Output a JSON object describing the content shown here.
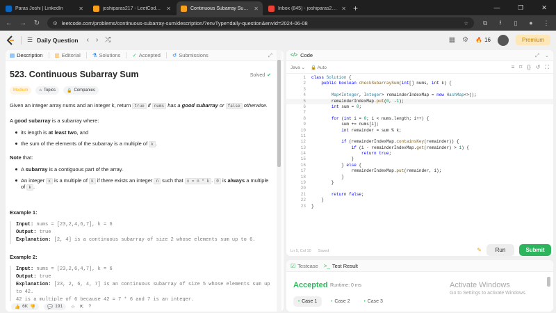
{
  "browser": {
    "tabs": [
      {
        "title": "Paras Joshi | LinkedIn",
        "color": "#0a66c2",
        "active": false
      },
      {
        "title": "joshiparas217 - LeetCode Profile",
        "color": "#f89f1b",
        "active": false
      },
      {
        "title": "Continuous Subarray Sum - LeetCode",
        "color": "#f89f1b",
        "active": true
      },
      {
        "title": "Inbox (845) - joshiparas217@gmail.com",
        "color": "#ea4335",
        "active": false
      }
    ],
    "url": "leetcode.com/problems/continuous-subarray-sum/description/?envType=daily-question&envId=2024-06-08"
  },
  "header": {
    "daily_question": "Daily Question",
    "streak": "16",
    "premium": "Premium"
  },
  "left_tabs": [
    "Description",
    "Editorial",
    "Solutions",
    "Accepted",
    "Submissions"
  ],
  "problem": {
    "title": "523. Continuous Subarray Sum",
    "solved": "Solved",
    "difficulty": "Medium",
    "topics": "Topics",
    "companies": "Companies",
    "intro_1": "Given an integer array nums and an integer k, return",
    "intro_true": "true",
    "intro_2": "if",
    "intro_nums": "nums",
    "intro_3": "has a",
    "intro_good": "good subarray",
    "intro_4": "or",
    "intro_false": "false",
    "intro_5": "otherwise.",
    "def_good": "good subarray",
    "def_prefix": "A",
    "def_suffix": "is a subarray where:",
    "bullet_1a": "its length is",
    "bullet_1b": "at least two",
    "bullet_1c": ", and",
    "bullet_2": "the sum of the elements of the subarray is a multiple of",
    "bullet_2k": "k",
    "note": "Note",
    "note_suffix": "that:",
    "note_1a": "A",
    "note_1b": "subarray",
    "note_1c": "is a contiguous part of the array.",
    "note_2a": "An integer",
    "note_2x": "x",
    "note_2b": "is a multiple of",
    "note_2k": "k",
    "note_2c": "if there exists an integer",
    "note_2n": "n",
    "note_2d": "such that",
    "note_2eq": "x = n * k",
    "note_2e": ".",
    "note_2zero": "0",
    "note_2f": "is",
    "note_2always": "always",
    "note_2g": "a multiple of",
    "note_2k2": "k",
    "note_2h": "."
  },
  "examples": [
    {
      "heading": "Example 1:",
      "input": "nums = [23,2,4,6,7], k = 6",
      "output": "true",
      "explanation": "[2, 4] is a continuous subarray of size 2 whose elements sum up to 6."
    },
    {
      "heading": "Example 2:",
      "input": "nums = [23,2,6,4,7], k = 6",
      "output": "true",
      "explanation": "[23, 2, 6, 4, 7] is an continuous subarray of size 5 whose elements sum up to 42.",
      "explanation_2": "42 is a multiple of 6 because 42 = 7 * 6 and 7 is an integer."
    }
  ],
  "labels": {
    "input": "Input:",
    "output": "Output:",
    "explanation": "Explanation:"
  },
  "left_footer": {
    "likes": "6K",
    "comments": "191"
  },
  "editor": {
    "title": "Code",
    "language": "Java",
    "mode": "Auto",
    "status": "Ln 5, Col 10",
    "saved": "Saved"
  },
  "code_lines": [
    "class Solution {",
    "    public boolean checkSubarraySum(int[] nums, int k) {",
    "",
    "        Map<Integer, Integer> remainderIndexMap = new HashMap<>();",
    "        remainderIndexMap.put(0, -1);",
    "        int sum = 0;",
    "",
    "        for (int i = 0; i < nums.length; i++) {",
    "            sum += nums[i];",
    "            int remainder = sum % k;",
    "",
    "            if (remainderIndexMap.containsKey(remainder)) {",
    "                if (i - remainderIndexMap.get(remainder) > 1) {",
    "                    return true;",
    "                }",
    "            } else {",
    "                remainderIndexMap.put(remainder, i);",
    "            }",
    "        }",
    "",
    "        return false;",
    "    }",
    "}"
  ],
  "actions": {
    "run": "Run",
    "submit": "Submit"
  },
  "result": {
    "testcase_tab": "Testcase",
    "result_tab": "Test Result",
    "status": "Accepted",
    "runtime": "Runtime: 0 ms",
    "cases": [
      "Case 1",
      "Case 2",
      "Case 3"
    ]
  },
  "watermark": {
    "line1": "Activate Windows",
    "line2": "Go to Settings to activate Windows."
  },
  "colors": {
    "accent_green": "#2cbb5d",
    "medium": "#ffb800",
    "submit": "#2db55d"
  }
}
